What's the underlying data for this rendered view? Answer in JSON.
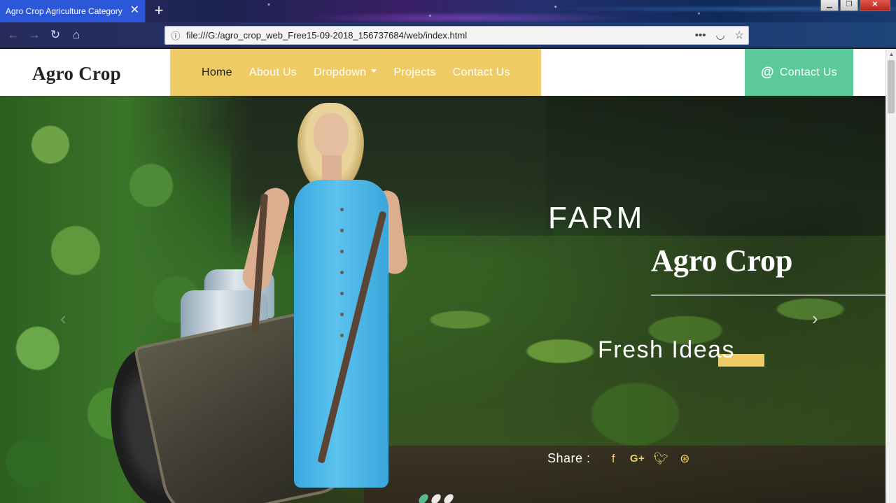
{
  "browser": {
    "tab_title": "Agro Crop Agriculture Category Bo",
    "close_glyph": "✕",
    "new_tab_glyph": "+",
    "url": "file:///G:/agro_crop_web_Free15-09-2018_156737684/web/index.html",
    "icons": [
      "back-icon",
      "forward-icon",
      "reload-icon",
      "home-icon",
      "info-icon",
      "page-actions-icon",
      "pocket-icon",
      "bookmark-star-icon",
      "library-icon",
      "sidebar-icon",
      "menu-icon"
    ]
  },
  "site": {
    "logo": "Agro Crop",
    "nav": {
      "home": "Home",
      "about": "About Us",
      "dropdown": "Dropdown",
      "projects": "Projects",
      "contact": "Contact Us"
    },
    "contact_button": "Contact Us",
    "colors": {
      "accent_yellow": "#efcb66",
      "accent_green": "#5cc99a"
    }
  },
  "slider": {
    "farm": "FARM",
    "title": "Agro Crop",
    "subtitle": "Fresh Ideas",
    "share_label": "Share :",
    "social": [
      "facebook-icon",
      "google-plus-icon",
      "twitter-icon",
      "dribbble-icon"
    ],
    "slide_count": 3,
    "active_slide": 1
  }
}
